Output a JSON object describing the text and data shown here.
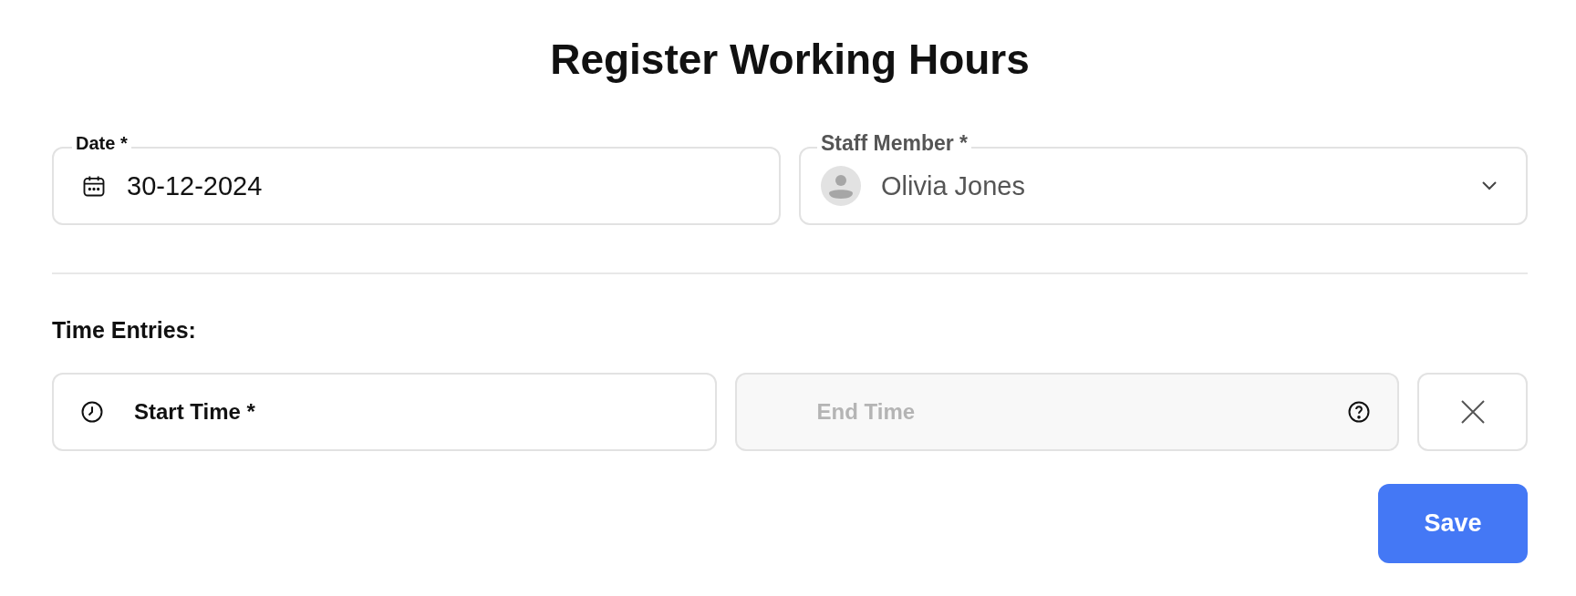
{
  "title": "Register Working Hours",
  "date": {
    "label": "Date *",
    "value": "30-12-2024"
  },
  "staff": {
    "label": "Staff Member *",
    "value": "Olivia Jones"
  },
  "section": "Time Entries:",
  "entries": [
    {
      "start": {
        "placeholder": "Start Time *",
        "disabled": false
      },
      "end": {
        "placeholder": "End Time",
        "disabled": true
      }
    }
  ],
  "save": "Save"
}
